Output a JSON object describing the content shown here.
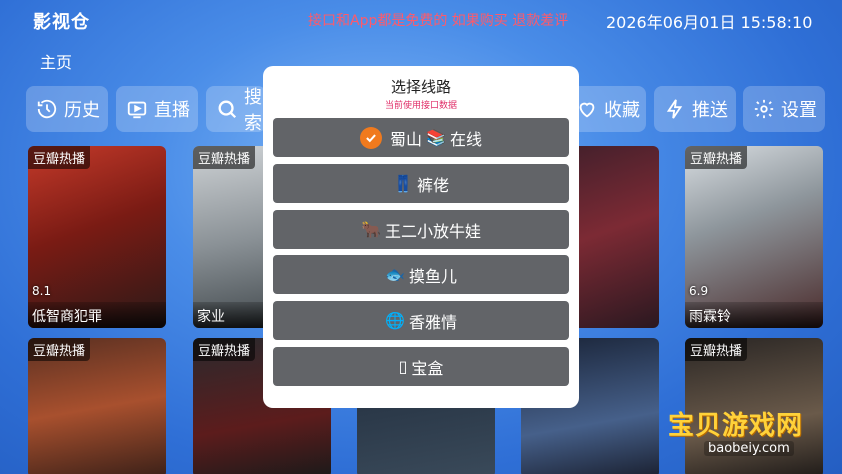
{
  "header": {
    "app_title": "影视仓",
    "notice": "接口和App都是免费的 如果购买 退款差评",
    "datetime": "2026年06月01日 15:58:10",
    "home_label": "主页"
  },
  "nav": {
    "history": "历史",
    "live": "直播",
    "search": "搜索",
    "favorites": "收藏",
    "push": "推送",
    "settings": "设置"
  },
  "cards": [
    {
      "badge": "豆瓣热播",
      "rating": "8.1",
      "title": "低智商犯罪"
    },
    {
      "badge": "豆瓣热播",
      "rating": "",
      "title": "家业"
    },
    {
      "badge": "",
      "rating": "",
      "title": ""
    },
    {
      "badge": "",
      "rating": "",
      "title": ""
    },
    {
      "badge": "豆瓣热播",
      "rating": "6.9",
      "title": "雨霖铃"
    },
    {
      "badge": "豆瓣热播",
      "rating": "",
      "title": ""
    },
    {
      "badge": "豆瓣热播",
      "rating": "",
      "title": ""
    },
    {
      "badge": "",
      "rating": "",
      "title": ""
    },
    {
      "badge": "",
      "rating": "",
      "title": ""
    },
    {
      "badge": "豆瓣热播",
      "rating": "",
      "title": ""
    }
  ],
  "dialog": {
    "title": "选择线路",
    "subtitle": "当前使用接口数据",
    "routes": [
      {
        "icon": "📚",
        "name_a": "蜀山",
        "name_b": "在线",
        "selected": true
      },
      {
        "icon": "👖",
        "name_a": "",
        "name_b": "裤佬",
        "selected": false
      },
      {
        "icon": "🐂",
        "name_a": "",
        "name_b": "王二小放牛娃",
        "selected": false
      },
      {
        "icon": "🐟",
        "name_a": "",
        "name_b": "摸鱼儿",
        "selected": false
      },
      {
        "icon": "🌐",
        "name_a": "",
        "name_b": "香雅情",
        "selected": false
      },
      {
        "icon": "▯",
        "name_a": "",
        "name_b": "宝盒",
        "selected": false
      }
    ]
  },
  "watermark": {
    "text": "宝贝游戏网",
    "url": "baobeiy.com"
  },
  "colors": {
    "background": "#2f6fd6",
    "dialog_bg": "#ffffff",
    "route_bg": "#626468",
    "selected_check": "#f07a1e",
    "notice": "#ff5a6a",
    "subtitle": "#e0306a"
  }
}
